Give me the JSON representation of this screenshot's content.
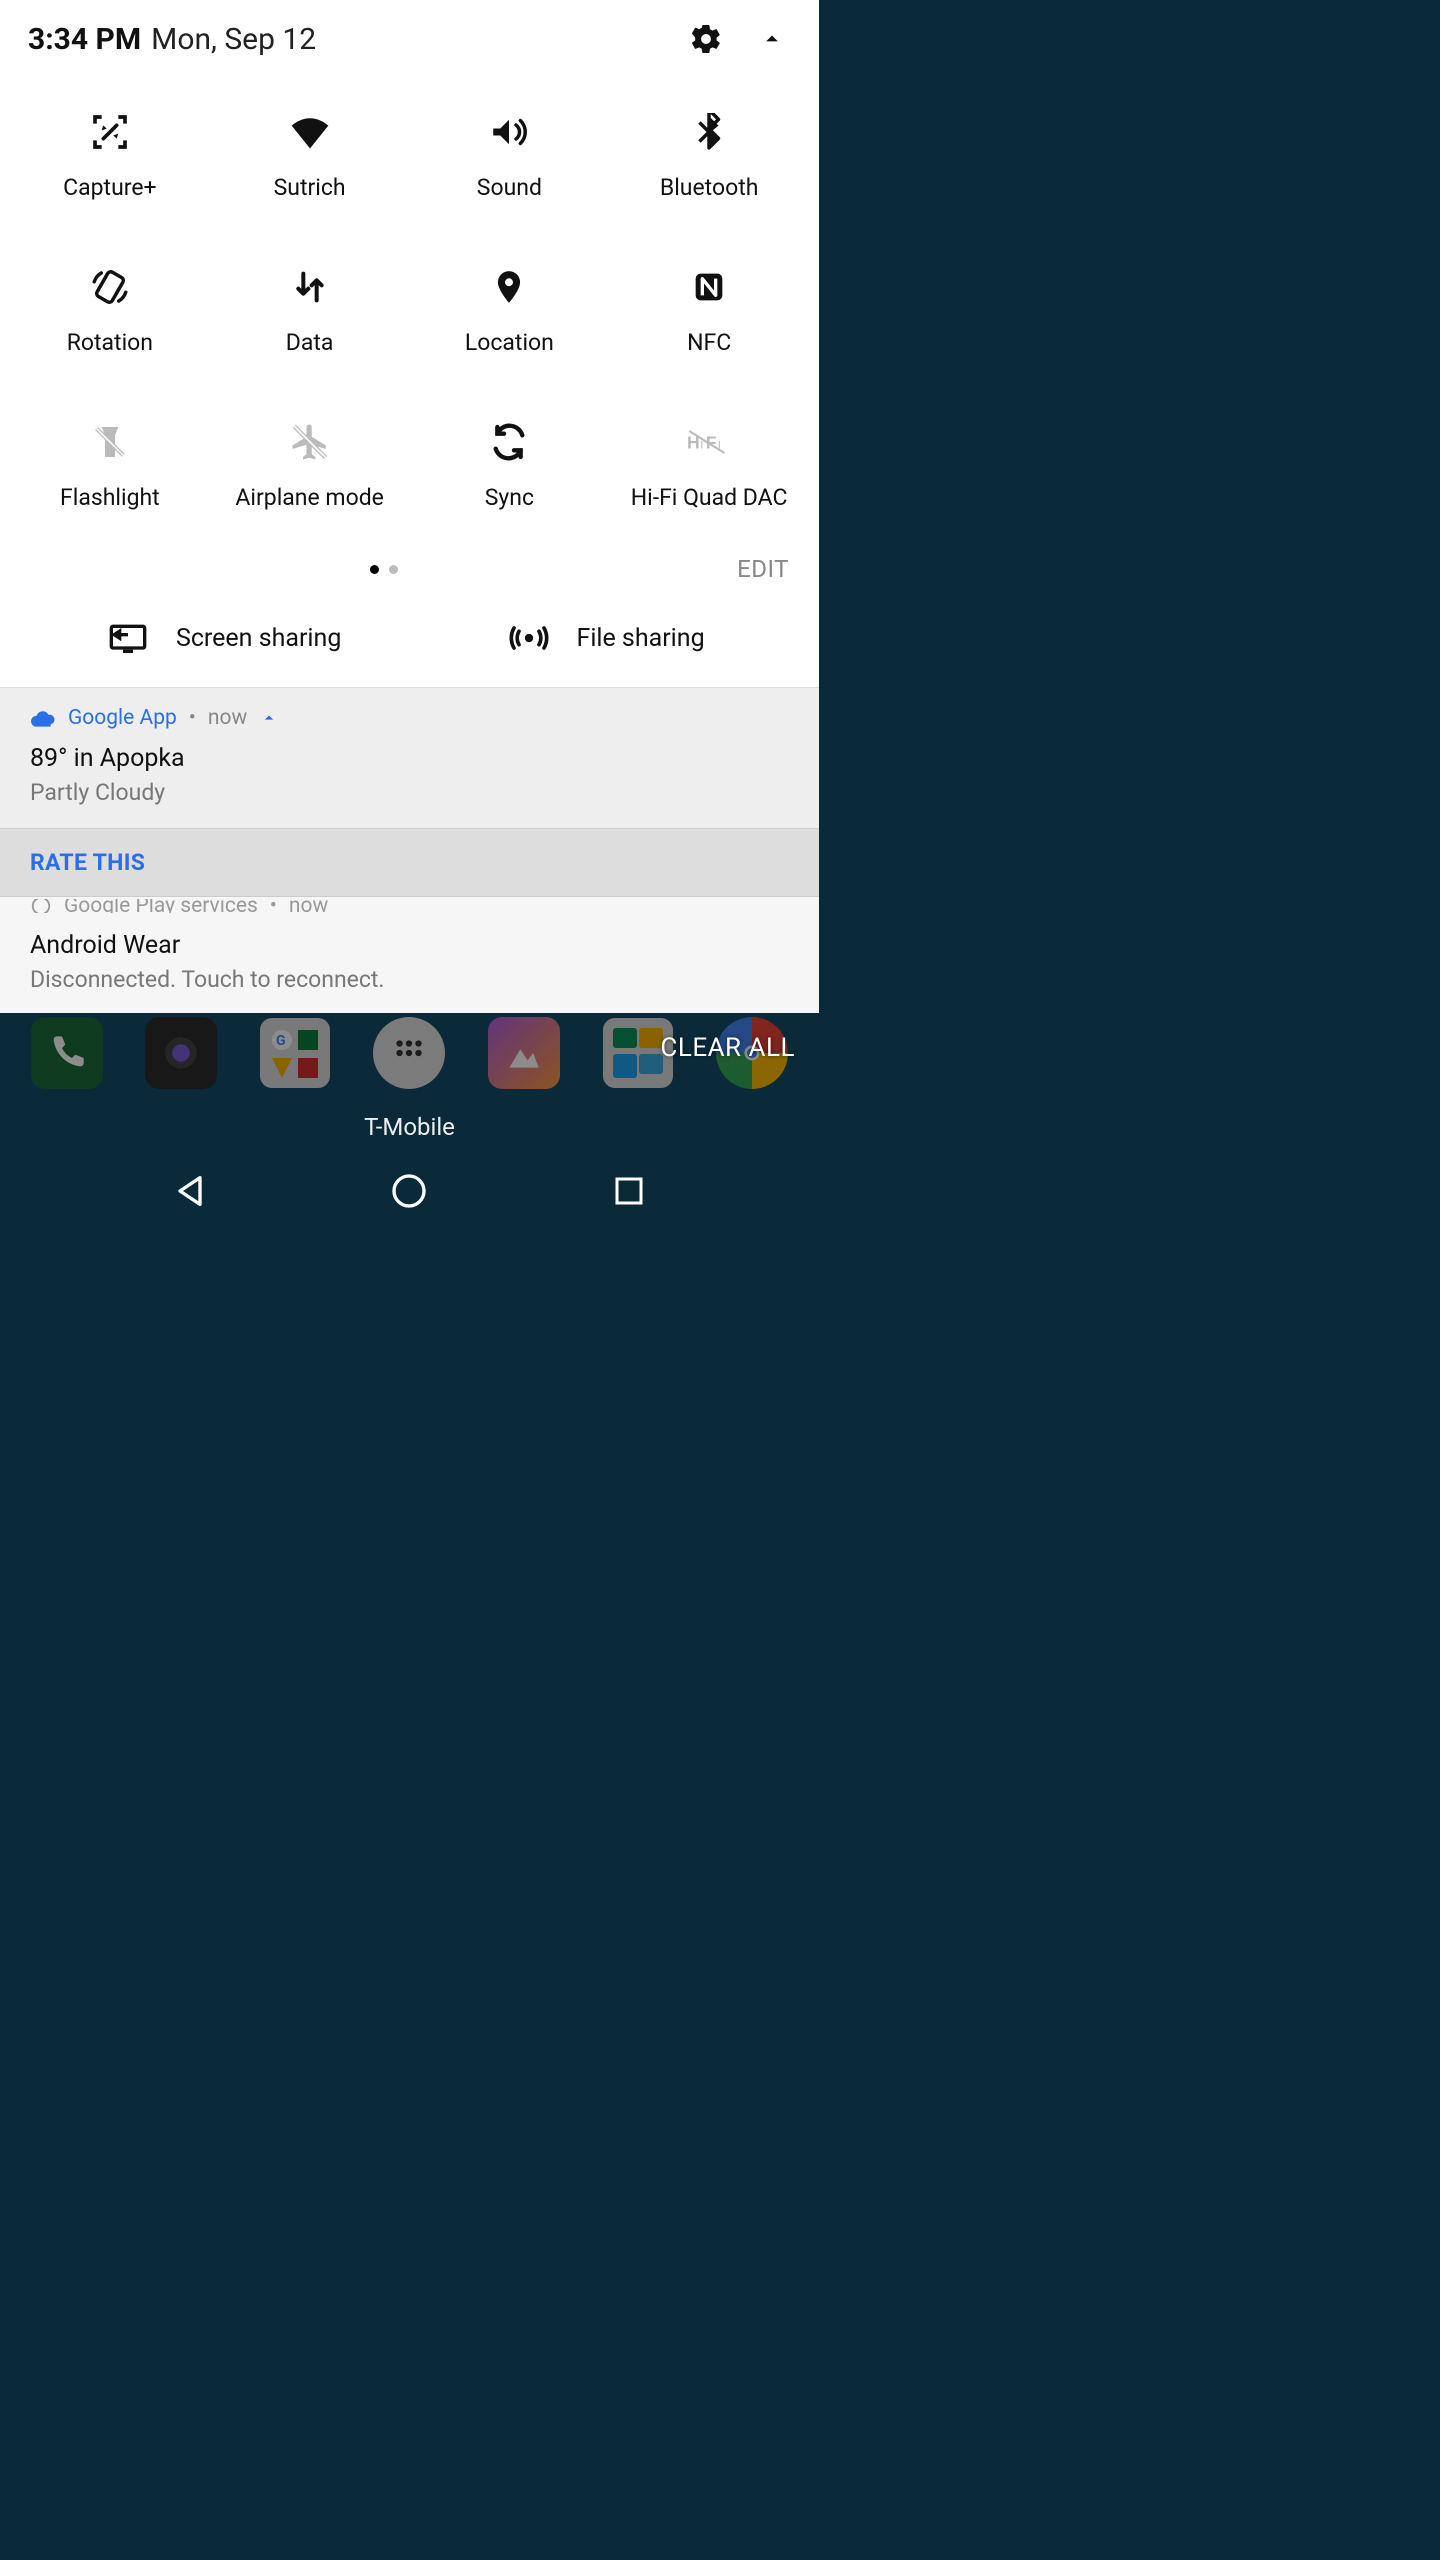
{
  "header": {
    "time": "3:34 PM",
    "date": "Mon, Sep 12"
  },
  "tiles": [
    {
      "label": "Capture+"
    },
    {
      "label": "Sutrich"
    },
    {
      "label": "Sound"
    },
    {
      "label": "Bluetooth"
    },
    {
      "label": "Rotation"
    },
    {
      "label": "Data"
    },
    {
      "label": "Location"
    },
    {
      "label": "NFC"
    },
    {
      "label": "Flashlight"
    },
    {
      "label": "Airplane mode"
    },
    {
      "label": "Sync"
    },
    {
      "label": "Hi-Fi Quad DAC"
    }
  ],
  "edit_label": "EDIT",
  "share": {
    "screen": "Screen sharing",
    "file": "File sharing"
  },
  "notif_weather": {
    "app": "Google App",
    "when": "now",
    "title": "89° in Apopka",
    "subtitle": "Partly Cloudy",
    "rate": "RATE THIS"
  },
  "notif_wear": {
    "app": "Google Play services",
    "when": "now",
    "title": "Android Wear",
    "subtitle": "Disconnected. Touch to reconnect."
  },
  "clear_all": "CLEAR ALL",
  "carrier": "T-Mobile"
}
